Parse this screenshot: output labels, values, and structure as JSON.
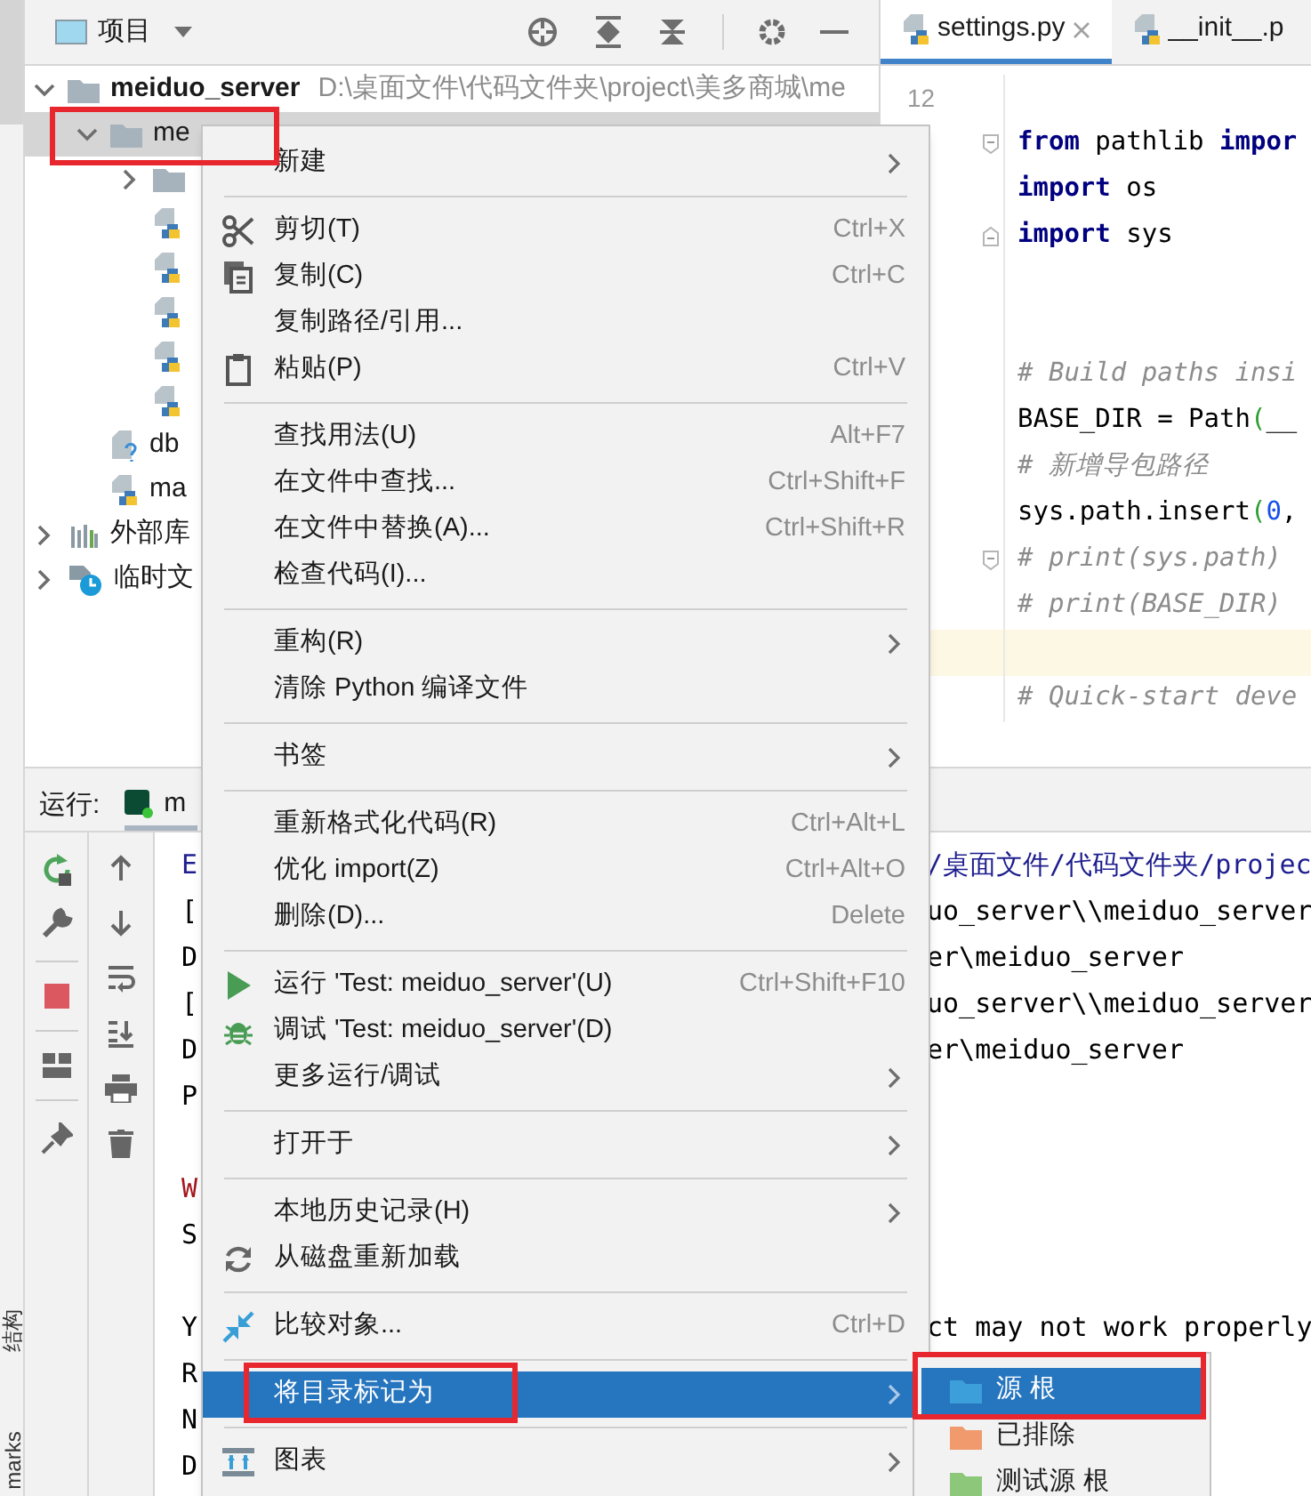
{
  "side_strip": {
    "labels": [
      "结构",
      "marks"
    ]
  },
  "project_panel": {
    "title": "项目",
    "tree": [
      {
        "label": "meiduo_server",
        "path": "D:\\桌面文件\\代码文件夹\\project\\美多商城\\me",
        "kind": "folder",
        "expanded": true,
        "selected": false,
        "children": [
          {
            "label": "me",
            "kind": "folder",
            "expanded": true,
            "selected": true,
            "children": [
              {
                "kind": "folder",
                "expanded": false,
                "selected": false
              },
              {
                "kind": "python",
                "selected": false
              },
              {
                "kind": "python",
                "selected": false
              },
              {
                "kind": "python",
                "selected": false
              },
              {
                "kind": "python",
                "selected": false
              },
              {
                "kind": "python",
                "selected": false
              }
            ]
          },
          {
            "label": "db",
            "kind": "unknown",
            "selected": false
          },
          {
            "label": "ma",
            "kind": "python",
            "selected": false
          }
        ]
      },
      {
        "label": "外部库",
        "kind": "library",
        "expanded": false,
        "selected": false
      },
      {
        "label": "临时文",
        "kind": "scratch",
        "expanded": false,
        "selected": false
      }
    ]
  },
  "editor": {
    "tabs": [
      {
        "label": "settings.py",
        "selected": true,
        "closable": true
      },
      {
        "label": "__init__.p",
        "selected": false,
        "closable": false
      }
    ],
    "lines": [
      {
        "kind": "plain",
        "number": "12"
      },
      {
        "kind": "fold-start",
        "tokens": [
          {
            "text": "from",
            "kind": "keyword"
          },
          {
            "text": " pathlib ",
            "kind": "plain"
          },
          {
            "text": "impor",
            "kind": "keyword"
          }
        ]
      },
      {
        "kind": "plain",
        "tokens": [
          {
            "text": "import",
            "kind": "keyword"
          },
          {
            "text": " os",
            "kind": "plain"
          }
        ]
      },
      {
        "kind": "fold-end",
        "tokens": [
          {
            "text": "import",
            "kind": "keyword"
          },
          {
            "text": " sys",
            "kind": "plain"
          }
        ]
      },
      {
        "kind": "plain"
      },
      {
        "kind": "plain"
      },
      {
        "kind": "plain",
        "tokens": [
          {
            "text": "# Build paths insi",
            "kind": "comment"
          }
        ]
      },
      {
        "kind": "plain",
        "tokens": [
          {
            "text": "BASE_DIR = Path",
            "kind": "plain"
          },
          {
            "text": "(",
            "kind": "paren"
          },
          {
            "text": "__",
            "kind": "plain"
          }
        ]
      },
      {
        "kind": "plain",
        "tokens": [
          {
            "text": "# 新增导包路径",
            "kind": "comment"
          }
        ]
      },
      {
        "kind": "plain",
        "tokens": [
          {
            "text": "sys.path.insert",
            "kind": "plain"
          },
          {
            "text": "(",
            "kind": "paren"
          },
          {
            "text": "0",
            "kind": "number"
          },
          {
            "text": ",",
            "kind": "plain"
          }
        ]
      },
      {
        "kind": "fold-start",
        "tokens": [
          {
            "text": "# print(sys.path)",
            "kind": "comment"
          }
        ]
      },
      {
        "kind": "plain",
        "tokens": [
          {
            "text": "# print(BASE_DIR)",
            "kind": "comment"
          }
        ]
      },
      {
        "kind": "plain",
        "highlighted": true
      },
      {
        "kind": "plain",
        "tokens": [
          {
            "text": "# Quick-start deve",
            "kind": "comment"
          }
        ]
      }
    ]
  },
  "run_panel": {
    "title": "运行:",
    "tab": "m",
    "console": [
      {
        "kind": "info",
        "head": "E",
        "tail": "/桌面文件/代码文件夹/projec"
      },
      {
        "kind": "plain",
        "head": "[",
        "tail": "uo_server\\\\meiduo_server"
      },
      {
        "kind": "plain",
        "head": "D",
        "tail": "er\\meiduo_server"
      },
      {
        "kind": "plain",
        "head": "[",
        "tail": "uo_server\\\\meiduo_server"
      },
      {
        "kind": "plain",
        "head": "D",
        "tail": "er\\meiduo_server"
      },
      {
        "kind": "plain",
        "head": "P"
      },
      {
        "kind": "blank"
      },
      {
        "kind": "warning",
        "head": "W"
      },
      {
        "kind": "plain",
        "head": "S"
      },
      {
        "kind": "blank"
      },
      {
        "kind": "plain",
        "head": "Y",
        "tail": "ct may not work properly"
      },
      {
        "kind": "plain",
        "head": "R"
      },
      {
        "kind": "plain",
        "head": "N"
      },
      {
        "kind": "plain",
        "head": "D"
      }
    ]
  },
  "context_menu": {
    "items": [
      {
        "kind": "item",
        "label": "新建",
        "submenu": true,
        "selected": false
      },
      {
        "kind": "separator"
      },
      {
        "kind": "item",
        "label": "剪切(T)",
        "shortcut": "Ctrl+X",
        "selected": false
      },
      {
        "kind": "item",
        "label": "复制(C)",
        "shortcut": "Ctrl+C",
        "selected": false
      },
      {
        "kind": "item",
        "label": "复制路径/引用...",
        "selected": false
      },
      {
        "kind": "item",
        "label": "粘贴(P)",
        "shortcut": "Ctrl+V",
        "selected": false
      },
      {
        "kind": "separator"
      },
      {
        "kind": "item",
        "label": "查找用法(U)",
        "shortcut": "Alt+F7",
        "selected": false
      },
      {
        "kind": "item",
        "label": "在文件中查找...",
        "shortcut": "Ctrl+Shift+F",
        "selected": false
      },
      {
        "kind": "item",
        "label": "在文件中替换(A)...",
        "shortcut": "Ctrl+Shift+R",
        "selected": false
      },
      {
        "kind": "item",
        "label": "检查代码(I)...",
        "selected": false
      },
      {
        "kind": "separator"
      },
      {
        "kind": "item",
        "label": "重构(R)",
        "submenu": true,
        "selected": false
      },
      {
        "kind": "item",
        "label": "清除 Python 编译文件",
        "selected": false
      },
      {
        "kind": "separator"
      },
      {
        "kind": "item",
        "label": "书签",
        "submenu": true,
        "selected": false
      },
      {
        "kind": "separator"
      },
      {
        "kind": "item",
        "label": "重新格式化代码(R)",
        "shortcut": "Ctrl+Alt+L",
        "selected": false
      },
      {
        "kind": "item",
        "label": "优化 import(Z)",
        "shortcut": "Ctrl+Alt+O",
        "selected": false
      },
      {
        "kind": "item",
        "label": "删除(D)...",
        "shortcut": "Delete",
        "selected": false
      },
      {
        "kind": "separator"
      },
      {
        "kind": "item",
        "label": "运行 'Test: meiduo_server'(U)",
        "shortcut": "Ctrl+Shift+F10",
        "selected": false
      },
      {
        "kind": "item",
        "label": "调试 'Test: meiduo_server'(D)",
        "selected": false
      },
      {
        "kind": "item",
        "label": "更多运行/调试",
        "submenu": true,
        "selected": false
      },
      {
        "kind": "separator"
      },
      {
        "kind": "item",
        "label": "打开于",
        "submenu": true,
        "selected": false
      },
      {
        "kind": "separator"
      },
      {
        "kind": "item",
        "label": "本地历史记录(H)",
        "submenu": true,
        "selected": false
      },
      {
        "kind": "item",
        "label": "从磁盘重新加载",
        "selected": false
      },
      {
        "kind": "separator"
      },
      {
        "kind": "item",
        "label": "比较对象...",
        "shortcut": "Ctrl+D",
        "selected": false
      },
      {
        "kind": "separator"
      },
      {
        "kind": "item",
        "label": "将目录标记为",
        "submenu": true,
        "selected": true
      },
      {
        "kind": "separator"
      },
      {
        "kind": "item",
        "label": "图表",
        "submenu": true,
        "selected": false
      }
    ]
  },
  "submenu": {
    "items": [
      {
        "label": "源 根",
        "color": "#3d9fd9",
        "selected": true
      },
      {
        "label": "已排除",
        "color": "#f09a6e",
        "selected": false
      },
      {
        "label": "测试源 根",
        "color": "#8cc77a",
        "selected": false
      }
    ]
  }
}
